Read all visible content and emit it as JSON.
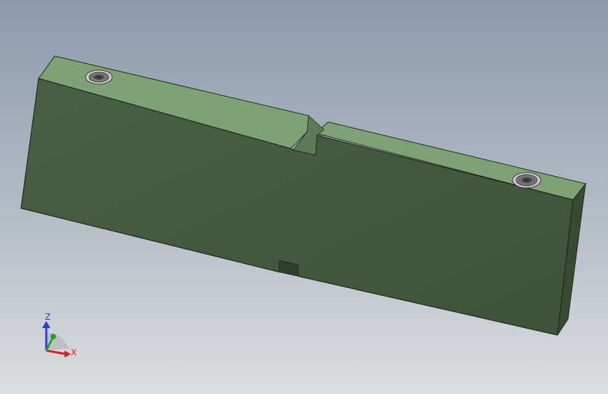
{
  "viewport": {
    "background_top": "#8e9aab",
    "background_bottom": "#dcdedf"
  },
  "part": {
    "front_face_color": "#445840",
    "top_face_color": "#7ea275",
    "right_face_color": "#374a34",
    "edge_color": "#1d2a1b",
    "hole_count": 2,
    "slot_count": 2
  },
  "triad": {
    "z_label": "Z",
    "x_label": "X",
    "z_color": "#2c3ed8",
    "x_color": "#d42020",
    "y_color": "#2a9c2a"
  }
}
